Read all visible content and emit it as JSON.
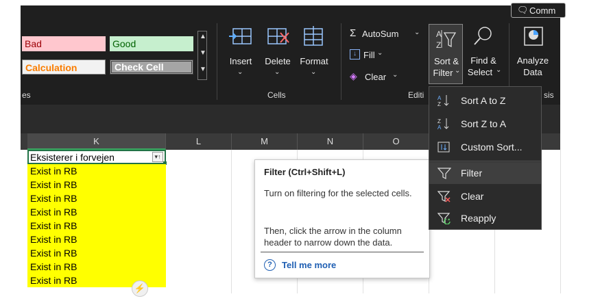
{
  "topbar": {
    "comments_label": "Comm"
  },
  "styles": {
    "bad": "Bad",
    "good": "Good",
    "calculation": "Calculation",
    "check_cell": "Check Cell",
    "group_label": "es"
  },
  "cells_group": {
    "insert": "Insert",
    "delete": "Delete",
    "format": "Format",
    "label": "Cells"
  },
  "editing_group": {
    "autosum": "AutoSum",
    "fill": "Fill",
    "clear": "Clear",
    "sort_filter_line1": "Sort &",
    "sort_filter_line2": "Filter",
    "find_select_line1": "Find &",
    "find_select_line2": "Select",
    "label": "Editi"
  },
  "analysis_group": {
    "analyze_line1": "Analyze",
    "analyze_line2": "Data",
    "label": "sis"
  },
  "columns": [
    "K",
    "L",
    "M",
    "N",
    "O"
  ],
  "sheet": {
    "header_cell": "Eksisterer i forvejen",
    "rows": [
      "Exist in RB",
      "Exist in RB",
      "Exist in RB",
      "Exist in RB",
      "Exist in RB",
      "Exist in RB",
      "Exist in RB",
      "Exist in RB",
      "Exist in RB"
    ]
  },
  "sort_menu": {
    "sort_az": "Sort A to Z",
    "sort_za": "Sort Z to A",
    "custom_sort": "Custom Sort...",
    "filter": "Filter",
    "clear": "Clear",
    "reapply": "Reapply"
  },
  "tooltip": {
    "title": "Filter (Ctrl+Shift+L)",
    "para1": "Turn on filtering for the selected cells.",
    "para2": "Then, click the arrow in the column header to narrow down the data.",
    "link": "Tell me more"
  },
  "colors": {
    "ribbon_bg": "#1f1f1f",
    "highlight_yellow": "#ffff00",
    "selection_green": "#217346",
    "menu_bg": "#2b2b2b"
  }
}
